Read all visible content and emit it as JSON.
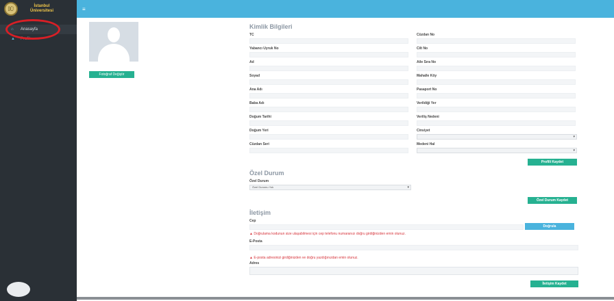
{
  "brand": {
    "logo_text": "İÜ",
    "line1": "İstanbul",
    "line2": "Üniversitesi"
  },
  "sidebar": {
    "items": [
      {
        "label": "Anasayfa"
      },
      {
        "label": "Profil"
      }
    ]
  },
  "topbar": {
    "menu_icon": "≡"
  },
  "profile": {
    "photo_button": "Fotoğraf Değiştir"
  },
  "kimlik": {
    "title": "Kimlik Bilgileri",
    "left_fields": [
      "TC",
      "Yabancı Uyruk No",
      "Ad",
      "Soyad",
      "Ana Adı",
      "Baba Adı",
      "Doğum Tarihi",
      "Doğum Yeri",
      "Cüzdan Seri"
    ],
    "right_fields": [
      "Cüzdan No",
      "Cilt No",
      "Aile Sıra No",
      "Mahalle Köy",
      "Pasaport No",
      "Verildiği Yer",
      "Veriliş Nedeni",
      "Cinsiyet",
      "Medeni Hal"
    ],
    "save_button": "Profili Kaydet"
  },
  "ozel": {
    "title": "Özel Durum",
    "label": "Özel Durum",
    "select_value": "Özel Durumu Yok",
    "save_button": "Özel Durum Kaydet"
  },
  "iletisim": {
    "title": "İletişim",
    "phone_label": "Cep",
    "verify_button": "Doğrula",
    "phone_warning": "Doğrulama kodunun size ulaşabilmesi için cep telefonu numaranızı doğru girdiğinizden emin olunuz.",
    "email_label": "E-Posta",
    "email_warning": "E-posta adresinizi girdiğinizden ve doğru yazdığınızdan emin olunuz.",
    "address_label": "Adres",
    "save_button": "İletişim Kaydet"
  }
}
